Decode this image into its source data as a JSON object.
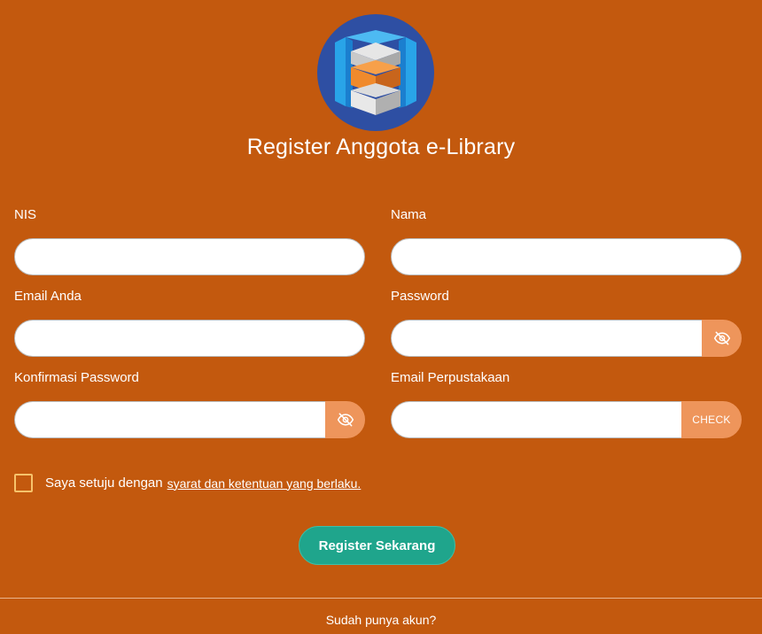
{
  "header": {
    "title": "Register Anggota e-Library",
    "logo_icon": "library-cube-logo"
  },
  "form": {
    "nis": {
      "label": "NIS",
      "value": "",
      "placeholder": ""
    },
    "nama": {
      "label": "Nama",
      "value": "",
      "placeholder": ""
    },
    "email": {
      "label": "Email Anda",
      "value": "",
      "placeholder": ""
    },
    "password": {
      "label": "Password",
      "value": "",
      "placeholder": "",
      "toggle_icon": "eye-slash-icon"
    },
    "confirm_password": {
      "label": "Konfirmasi Password",
      "value": "",
      "placeholder": "",
      "toggle_icon": "eye-slash-icon"
    },
    "library_email": {
      "label": "Email Perpustakaan",
      "value": "",
      "placeholder": "",
      "check_label": "CHECK"
    }
  },
  "agreement": {
    "checked": false,
    "text": "Saya setuju dengan",
    "link_text": "syarat dan ketentuan yang berlaku."
  },
  "register_button": {
    "label": "Register Sekarang"
  },
  "footer": {
    "have_account_text": "Sudah punya akun?"
  },
  "colors": {
    "background": "#c3590e",
    "addon": "#ee955b",
    "primary_button": "#1fa58c",
    "checkbox_border": "#f7c36b"
  }
}
